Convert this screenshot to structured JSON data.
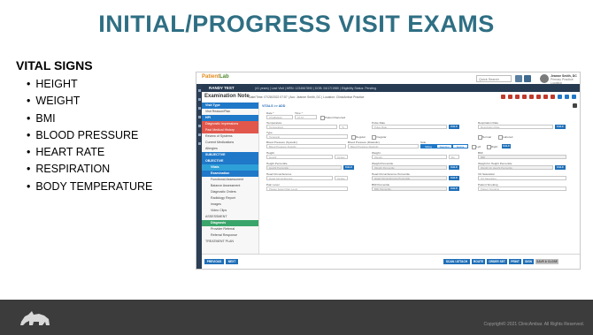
{
  "slide": {
    "title": "INITIAL/PROGRESS VISIT EXAMS",
    "section_heading": "VITAL SIGNS",
    "vitals": [
      "HEIGHT",
      "WEIGHT",
      "BMI",
      "BLOOD PRESSURE",
      "HEART RATE",
      "RESPIRATION",
      "BODY TEMPERATURE"
    ],
    "copyright": "Copyright© 2021 ClinicAmbar. All Rights Reserved.",
    "logo_icon": "rhino-icon"
  },
  "app": {
    "logo_main": "Patient",
    "logo_accent": "Lab",
    "search_placeholder": "Quick Search",
    "user_name": "Jeanne Smith, DC",
    "user_sub": "Primary Practice Location",
    "patient_name": "RANDY TEST",
    "patient_details": "(41 years) | Last Visit | MRN: 1234567890 | DOB: 04/17/1980 | Eligibility Status: Pending",
    "note_title": "Examination Note",
    "note_meta": "Date/Time: 07/28/2022 07:57 | Acc: Jeanne Smith, DC | Location: ClinicAmbar Practice",
    "menu": [
      {
        "label": "Visit Type",
        "style": "blue"
      },
      {
        "label": "Visit Reason/Plan",
        "style": "plain"
      },
      {
        "label": "HPI",
        "style": "blue"
      },
      {
        "label": "Diagnostic Impressions",
        "style": "red"
      },
      {
        "label": "Past Medical History",
        "style": "red"
      },
      {
        "label": "Review of Systems",
        "style": "plain"
      },
      {
        "label": "Current Medications",
        "style": "plain"
      },
      {
        "label": "Allergies",
        "style": "plain"
      },
      {
        "label": "SUBJECTIVE",
        "style": "blue"
      },
      {
        "label": "OBJECTIVE",
        "style": "blue"
      },
      {
        "label": "Vitals",
        "style": "active"
      },
      {
        "label": "Examination",
        "style": "blue"
      },
      {
        "label": "Functional Assessment",
        "style": "plain"
      },
      {
        "label": "Balance Assessment",
        "style": "plain"
      },
      {
        "label": "Diagnostic Orders",
        "style": "plain"
      },
      {
        "label": "Radiology Report",
        "style": "plain"
      },
      {
        "label": "Images",
        "style": "plain"
      },
      {
        "label": "Video Clips",
        "style": "plain"
      },
      {
        "label": "ASSESSMENT",
        "style": "plain"
      },
      {
        "label": "Diagnosis",
        "style": "green"
      },
      {
        "label": "Provider Referral",
        "style": "plain"
      },
      {
        "label": "Referral Response",
        "style": "plain"
      },
      {
        "label": "TREATMENT PLAN",
        "style": "plain"
      }
    ],
    "form": {
      "section_title": "VITALS >> ADD",
      "date_label": "Date *",
      "date_value": "07/28/2022",
      "time_label": "Time *",
      "time_value": "07:57",
      "patient_reported_label": "Patient Reported",
      "temperature_label": "Temperature",
      "temperature_placeholder": "Temperature",
      "temp_unit": "°F",
      "pulse_label": "Pulse Rate",
      "pulse_placeholder": "Pulse Rate",
      "resp_label": "Respiration Rate",
      "resp_placeholder": "Respiration Rate",
      "type_label": "Type",
      "type_placeholder": "Temporal",
      "regular_label": "Regular",
      "irregular_label": "Irregular",
      "normal_label": "Normal",
      "labored_label": "Labored",
      "bp_sys_label": "Blood Pressure (Systolic)",
      "bp_sys_placeholder": "Blood Pressure Systolic",
      "bp_dia_label": "Blood Pressure (Diastolic)",
      "bp_dia_placeholder": "Blood Pressure Diastolic",
      "side_label": "Side",
      "position_options": [
        "Sitting",
        "Standing",
        "Supine"
      ],
      "left_label": "Left",
      "right_label": "Right",
      "height_label": "Height",
      "height_placeholder": "Height",
      "height_unit": "Inches",
      "weight_label": "Weight",
      "weight_placeholder": "Weight",
      "weight_unit": "lbs",
      "bmi_label": "BMI",
      "bmi_placeholder": "BMI",
      "hp_label": "Height Percentile",
      "hp_placeholder": "Height Percentile",
      "wp_label": "Weight Percentile",
      "wp_placeholder": "Weight Percentile",
      "wfh_label": "Weight for Height Percentile",
      "wfh_placeholder": "Weight for Height Percentile",
      "hc_label": "Head Circumference",
      "hc_placeholder": "Head Circumference",
      "hc_unit": "Inches",
      "hcp_label": "Head Circumference Percentile",
      "hcp_placeholder": "Head Circumference Percentile",
      "o2_label": "O2 Saturation",
      "o2_placeholder": "O2 Saturation",
      "pain_label": "Pain Level",
      "pain_placeholder": "Please Select Pain Level",
      "bmip_label": "BMI Percentile",
      "bmip_placeholder": "BMI Percentile",
      "patient_smoking_label": "Patient Smoking",
      "patient_smoking_placeholder": "Patient Smoking",
      "calc_button": "CALC"
    },
    "bottom_buttons": {
      "previous": "PREVIOUS",
      "next": "NEXT",
      "scan_attach": "SCAN / ATTACH",
      "route": "ROUTE",
      "order_set": "ORDER SET",
      "print": "PRINT",
      "sign": "SIGN",
      "save_close": "SAVE & CLOSE"
    }
  }
}
